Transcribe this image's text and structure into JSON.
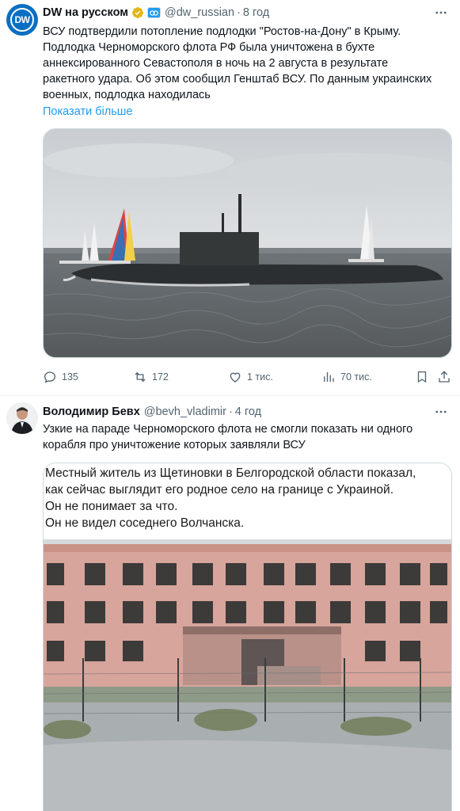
{
  "tweet1": {
    "author_name": "DW на русском",
    "handle": "@dw_russian",
    "separator": "·",
    "time": "8 год",
    "avatar_text": "DW",
    "text_lines": [
      "ВСУ подтвердили потопление подлодки \"Ростов-на-Дону\" в Крыму.",
      "Подлодка Черноморского флота РФ была уничтожена в бухте",
      "аннексированного Севастополя в ночь на 2 августа в результате",
      "ракетного удара. Об этом сообщил Генштаб ВСУ. По данным украинских",
      "военных, подлодка находилась"
    ],
    "show_more": "Показати більше",
    "replies": "135",
    "retweets": "172",
    "likes": "1 тис.",
    "views": "70 тис."
  },
  "tweet2": {
    "author_name": "Володимир Бевх",
    "handle": "@bevh_vladimir",
    "separator": "·",
    "time": "4 год",
    "text_lines": [
      "Узкие на параде Черноморского флота не смогли показать ни одного",
      "корабля про уничтожение которых заявляли ВСУ"
    ],
    "media_caption_lines": [
      "Местный житель из Щетиновки в Белгородской области показал,",
      "как сейчас выглядит его родное село на границе с Украиной.",
      "Он не понимает за что.",
      "Он не видел соседнего Волчанска."
    ]
  },
  "colors": {
    "accent": "#1d9bf0",
    "text_secondary": "#536471",
    "verified_gold": "#e2b719"
  },
  "icons": [
    "dw-logo-icon",
    "verified-badge-icon",
    "affiliate-badge-icon",
    "more-icon",
    "reply-icon",
    "retweet-icon",
    "like-icon",
    "views-icon",
    "share-icon"
  ]
}
